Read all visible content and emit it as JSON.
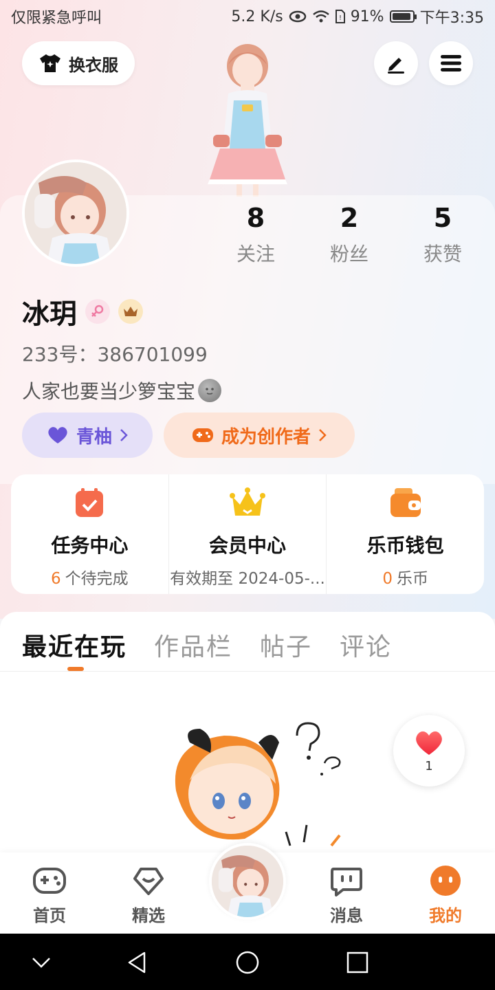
{
  "status_bar": {
    "left_text": "仅限紧急呼叫",
    "speed": "5.2 K/s",
    "battery": "91%",
    "time": "下午3:35"
  },
  "header": {
    "outfit_label": "换衣服",
    "edit_icon": "edit-icon",
    "menu_icon": "menu-icon"
  },
  "profile": {
    "stats": [
      {
        "num": "8",
        "label": "关注"
      },
      {
        "num": "2",
        "label": "粉丝"
      },
      {
        "num": "5",
        "label": "获赞"
      }
    ],
    "name": "冰玥",
    "uid_label": "233号：",
    "uid": "386701099",
    "bio": "人家也要当少箩宝宝"
  },
  "pills": {
    "membership": "青柚",
    "creator": "成为创作者"
  },
  "services": [
    {
      "title": "任务中心",
      "highlight": "6",
      "sub": "个待完成"
    },
    {
      "title": "会员中心",
      "highlight": "",
      "sub": "有效期至 2024-05-..."
    },
    {
      "title": "乐币钱包",
      "highlight": "0",
      "sub": "乐币"
    }
  ],
  "tabs": [
    "最近在玩",
    "作品栏",
    "帖子",
    "评论"
  ],
  "like_float": {
    "count": "1"
  },
  "bottom_nav": [
    {
      "label": "首页"
    },
    {
      "label": "精选"
    },
    {
      "label": "消息"
    },
    {
      "label": "我的"
    }
  ],
  "colors": {
    "accent": "#f07a2a",
    "purple": "#6a55d8"
  }
}
